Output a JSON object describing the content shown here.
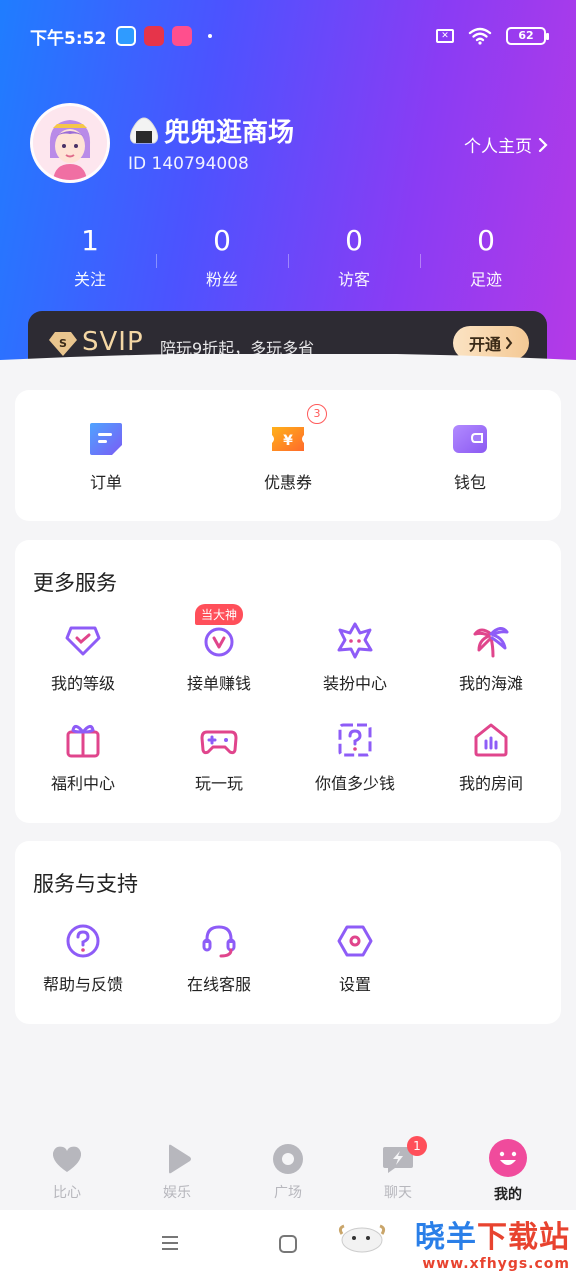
{
  "status_bar": {
    "time": "下午5:52",
    "battery": "62",
    "sim_label": "✕"
  },
  "profile": {
    "name": "兜兜逛商场",
    "id_text": "ID 140794008",
    "homepage_link": "个人主页"
  },
  "stats": [
    {
      "value": "1",
      "label": "关注"
    },
    {
      "value": "0",
      "label": "粉丝"
    },
    {
      "value": "0",
      "label": "访客"
    },
    {
      "value": "0",
      "label": "足迹"
    }
  ],
  "svip": {
    "title": "SVIP",
    "description": "陪玩9折起，多玩多省",
    "button": "开通"
  },
  "quick_actions": [
    {
      "label": "订单",
      "icon": "order-icon"
    },
    {
      "label": "优惠券",
      "icon": "coupon-icon",
      "badge": "3"
    },
    {
      "label": "钱包",
      "icon": "wallet-icon"
    }
  ],
  "more_services": {
    "title": "更多服务",
    "items": [
      {
        "label": "我的等级",
        "icon": "level-icon"
      },
      {
        "label": "接单赚钱",
        "icon": "earn-icon",
        "tag": "当大神"
      },
      {
        "label": "装扮中心",
        "icon": "dressup-icon"
      },
      {
        "label": "我的海滩",
        "icon": "beach-icon"
      },
      {
        "label": "福利中心",
        "icon": "gift-icon"
      },
      {
        "label": "玩一玩",
        "icon": "gamepad-icon"
      },
      {
        "label": "你值多少钱",
        "icon": "question-card-icon"
      },
      {
        "label": "我的房间",
        "icon": "room-icon"
      }
    ]
  },
  "support": {
    "title": "服务与支持",
    "items": [
      {
        "label": "帮助与反馈",
        "icon": "help-icon"
      },
      {
        "label": "在线客服",
        "icon": "headset-icon"
      },
      {
        "label": "设置",
        "icon": "settings-icon"
      }
    ]
  },
  "tabs": [
    {
      "label": "比心",
      "icon": "heart-icon"
    },
    {
      "label": "娱乐",
      "icon": "play-icon"
    },
    {
      "label": "广场",
      "icon": "plaza-icon"
    },
    {
      "label": "聊天",
      "icon": "chat-icon",
      "badge": "1"
    },
    {
      "label": "我的",
      "icon": "me-icon",
      "active": true
    }
  ],
  "watermark": {
    "title_blue": "晓羊",
    "title_red": "下载站",
    "url": "www.xfhygs.com"
  },
  "colors": {
    "accent_purple": "#8e5cf7",
    "accent_pink": "#e0458c",
    "badge_red": "#ff4f5a"
  }
}
